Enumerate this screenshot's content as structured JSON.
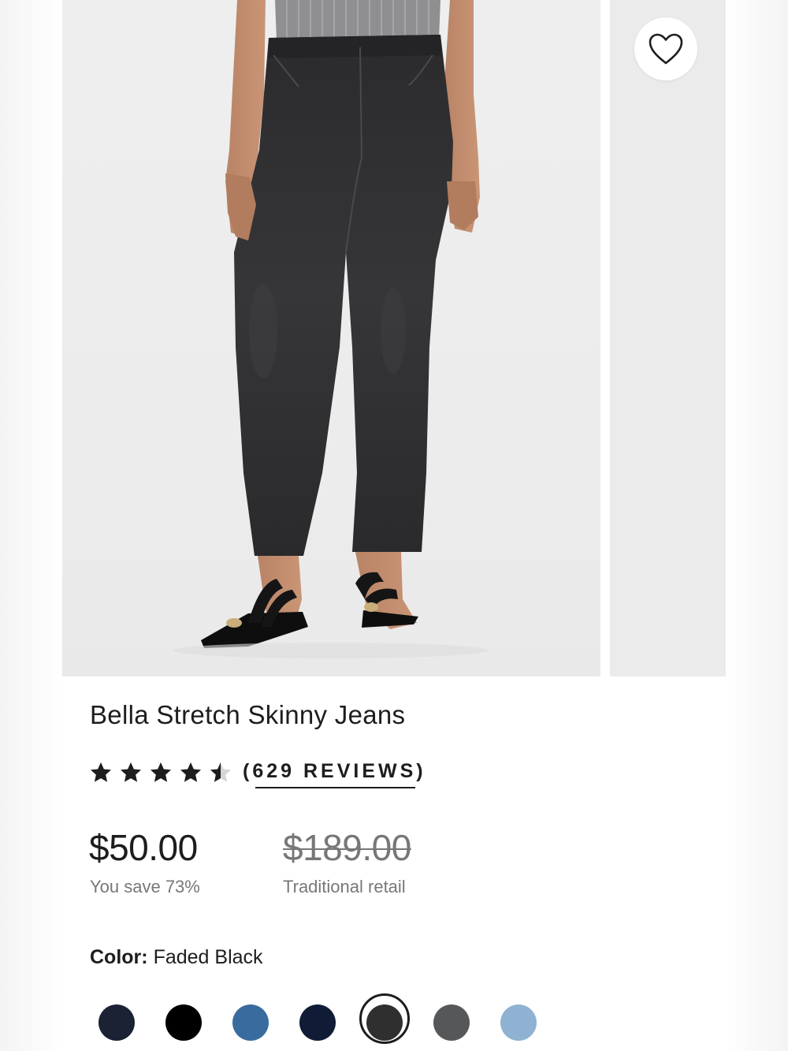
{
  "product": {
    "title": "Bella Stretch Skinny Jeans",
    "rating": 4.5,
    "rating_max": 5,
    "reviews_text": "(629 REVIEWS)"
  },
  "pricing": {
    "current": "$50.00",
    "savings": "You save 73%",
    "original": "$189.00",
    "original_label": "Traditional retail"
  },
  "color": {
    "label": "Color:",
    "selected": "Faded Black",
    "swatches": [
      {
        "hex": "#1a2233",
        "selected": false
      },
      {
        "hex": "#000000",
        "selected": false
      },
      {
        "hex": "#3a6b9e",
        "selected": false
      },
      {
        "hex": "#101c36",
        "selected": false
      },
      {
        "hex": "#2f2f30",
        "selected": true
      },
      {
        "hex": "#555759",
        "selected": false
      },
      {
        "hex": "#8fb2d2",
        "selected": false
      }
    ]
  },
  "icons": {
    "wishlist": "heart-icon",
    "star": "star-icon"
  },
  "colors": {
    "text": "#1d1d1d",
    "muted": "#777777",
    "photo_bg": "#ececec"
  }
}
